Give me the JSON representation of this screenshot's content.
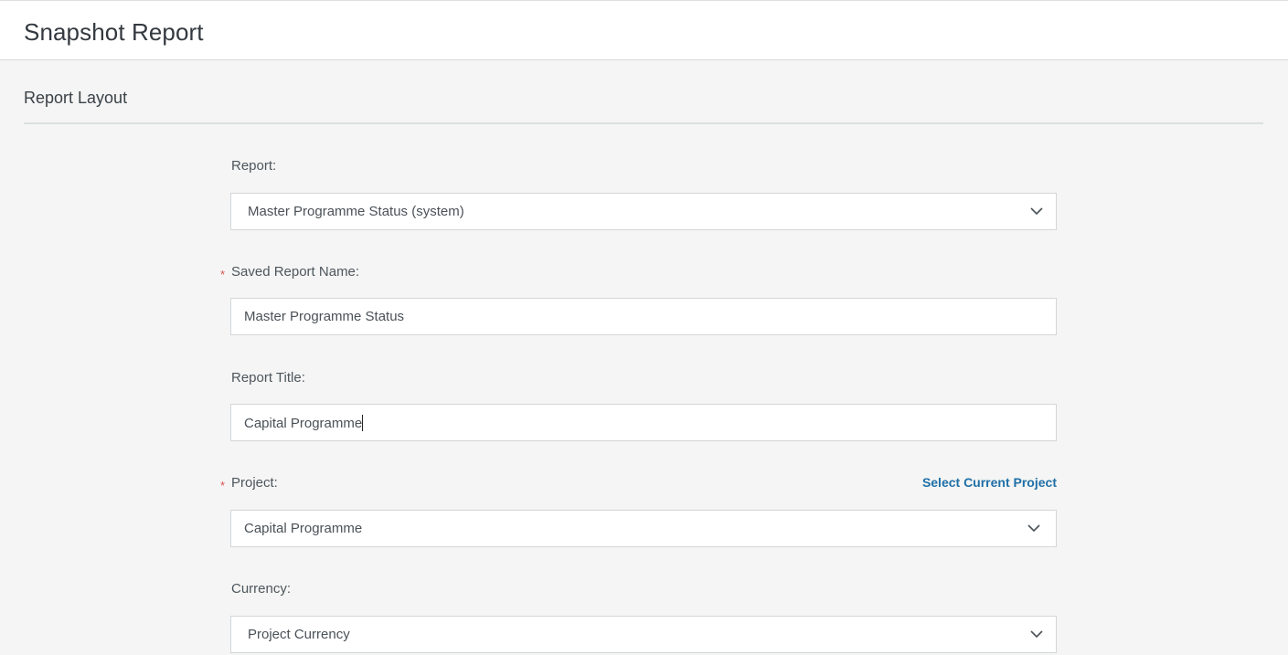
{
  "header": {
    "title": "Snapshot Report"
  },
  "section": {
    "title": "Report Layout"
  },
  "form": {
    "report": {
      "label": "Report:",
      "value": "Master Programme Status (system)",
      "icon": "chevron-down-icon"
    },
    "saved_report_name": {
      "label": "Saved Report Name:",
      "required_mark": "*",
      "value": "Master Programme Status"
    },
    "report_title": {
      "label": "Report Title:",
      "value": "Capital Programme"
    },
    "project": {
      "label": "Project:",
      "required_mark": "*",
      "value": "Capital Programme",
      "link": "Select Current Project",
      "icon": "chevron-down-icon"
    },
    "currency": {
      "label": "Currency:",
      "value": "Project Currency",
      "icon": "chevron-down-icon"
    }
  },
  "colors": {
    "background": "#f4f5f4",
    "link": "#1f6fa8",
    "required": "#d9534f"
  }
}
